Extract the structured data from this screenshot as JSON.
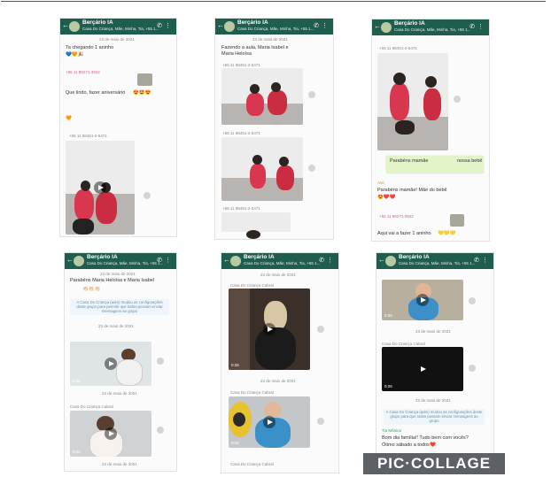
{
  "header": {
    "title": "Berçário IA",
    "subtitle": "Casa Do Criança, Mãe, Minha, Tia, +55 1..."
  },
  "panel1": {
    "date_top": "23 de maio de 2021",
    "msg1": "Ta chegando 1 aninho",
    "emoji1": "💙🧡🎉",
    "forward_label": "+55 11 98271-3922",
    "msg2": "Que lindo, fazer aniversário",
    "emoji2": "😍🤩😍",
    "date_mid": "+55 11 98451-2-5471"
  },
  "panel2": {
    "date_top": "23 de maio de 2021",
    "msg1": "Fazendo a aula, Maria Isabel e",
    "msg2": "Maria Heloísa",
    "label1": "+55 11 98451-2-5471",
    "label2": "+55 11 98451-2-5471",
    "label3": "+55 11 98451-2-5471"
  },
  "panel3": {
    "label1": "+55 11 98451-2-5471",
    "msg_green": "Parabéns mamãe",
    "msg_green2": "nossa bebê",
    "msg1": "Parabéns mamãe! Mãe do bebê",
    "emoji1": "😍❤️❤️",
    "forward_label": "+55 11 98271-3922",
    "msg2": "Aqui vai a fazer 1 aninho",
    "emoji2": "💛💛💛"
  },
  "panel4": {
    "date_top": "23 de maio de 2021",
    "msg1": "Parabéns Maria Heloísa e Maria Isabel",
    "emoji1": "👏🏻👏🏻👏🏻",
    "sys1": "A Casa Do Criança (adm) mudou as configurações deste grupo para permitir que todos possam enviar mensagens ao grupo",
    "date_mid": "23 de maio de 2021",
    "date_mid2": "23 de maio de 2021",
    "label1": "Casa Do Criança Cabral",
    "date_bottom": "23 de maio de 2021",
    "dur1": "0:26",
    "dur2": "0:26"
  },
  "panel5": {
    "date_top": "23 de maio de 2021",
    "label1": "Casa Do Criança Cabral",
    "date_mid": "23 de maio de 2021",
    "label2": "Casa Do Criança Cabral",
    "dur1": "0:26",
    "dur2": "0:26",
    "label3": "Casa Do Criança Cabral"
  },
  "panel6": {
    "date1": "23 de maio de 2021",
    "label1": "Casa Do Criança Cabral",
    "date2": "23 de maio de 2021",
    "sys1": "A Casa Do Criança (adm) mudou as configurações deste grupo para que todos possam enviar mensagens ao grupo",
    "msg_label": "Tia Mônica",
    "msg1": "Bom dia família!! Tudo bem com vocês?",
    "msg2": "Ótimo sábado a todos",
    "emoji": "❤️",
    "dur1": "0:26",
    "dur2": "0:26"
  },
  "watermark": "PIC·COLLAGE",
  "colors": {
    "header": "#1f5e4f",
    "green_bubble": "#e1f5c8",
    "watermark": "#5d6165"
  }
}
